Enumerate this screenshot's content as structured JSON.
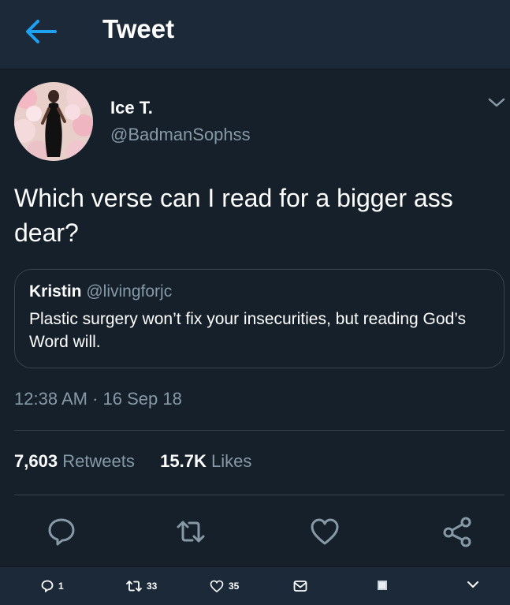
{
  "header": {
    "title": "Tweet",
    "back_icon": "arrow-left-icon",
    "accent_color": "#1da1f2"
  },
  "tweet": {
    "author_name": "Ice T.",
    "author_handle": "@BadmanSophss",
    "text": "Which verse can I read for a bigger ass dear?",
    "quoted": {
      "name": "Kristin",
      "handle": "@livingforjc",
      "text": "Plastic surgery won’t fix your insecurities, but reading God’s Word will."
    },
    "timestamp": "12:38 AM · 16 Sep 18",
    "retweets_count": "7,603",
    "retweets_label": "Retweets",
    "likes_count": "15.7K",
    "likes_label": "Likes"
  },
  "actions": [
    "reply-icon",
    "retweet-icon",
    "heart-icon",
    "share-icon"
  ],
  "bottom_bar": {
    "reply_count": "1",
    "retweet_count": "33",
    "like_count": "35"
  },
  "colors": {
    "background": "#15202b",
    "header_bg": "#1c2938",
    "secondary_text": "#8899a6",
    "border": "#38444d"
  }
}
